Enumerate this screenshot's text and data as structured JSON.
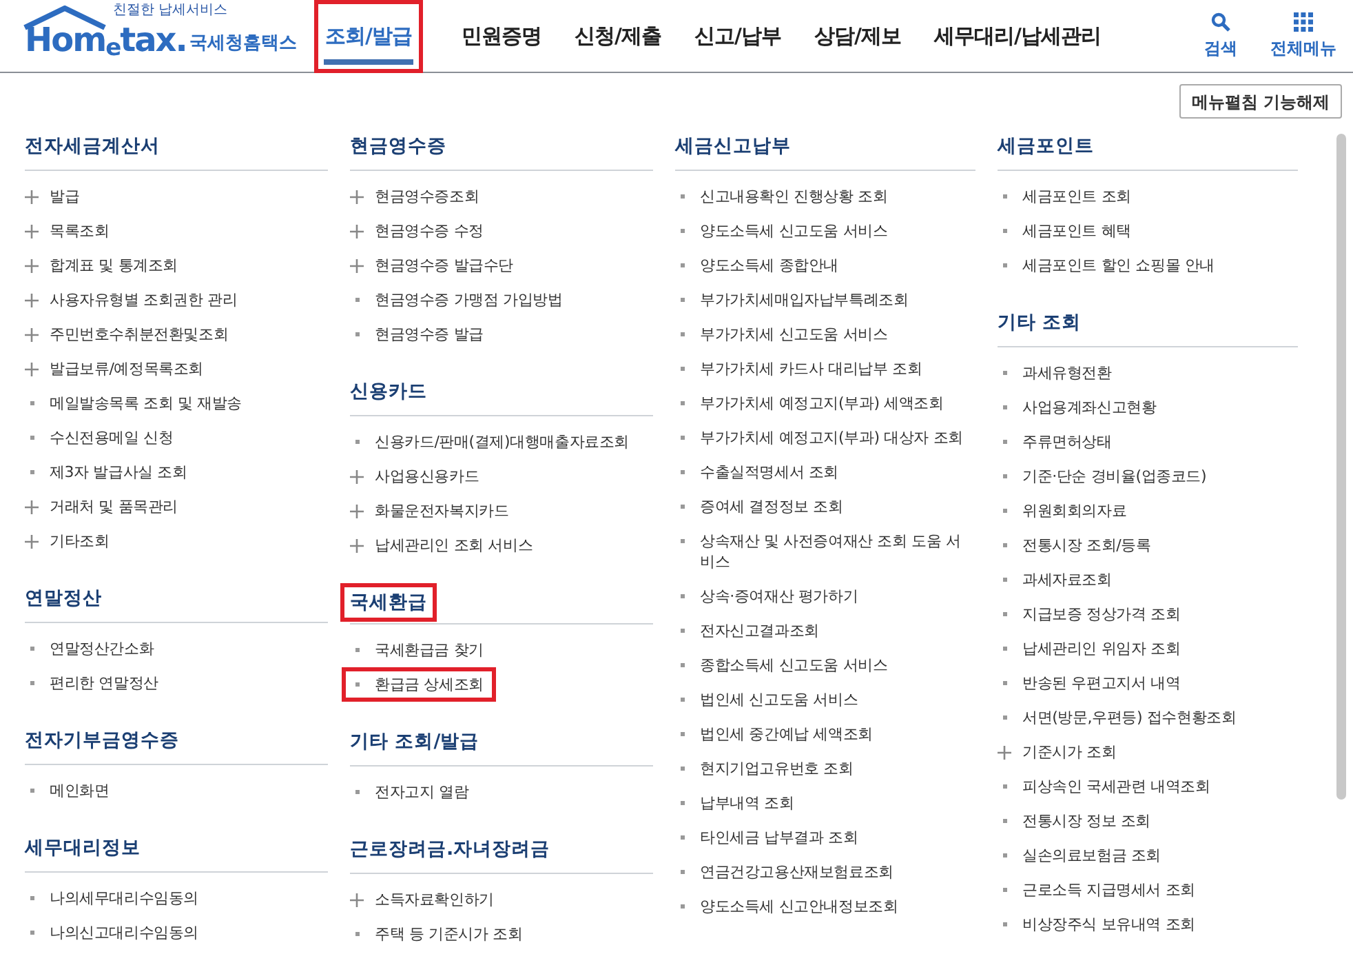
{
  "logo": {
    "slogan": "친절한 납세서비스",
    "wordmark": "Hom$_{e}$tax.",
    "name": "국세청홈택스"
  },
  "tabs": [
    {
      "label": "조회/발급",
      "selected": true,
      "highlighted": true
    },
    {
      "label": "민원증명",
      "selected": false,
      "highlighted": false
    },
    {
      "label": "신청/제출",
      "selected": false,
      "highlighted": false
    },
    {
      "label": "신고/납부",
      "selected": false,
      "highlighted": false
    },
    {
      "label": "상담/제보",
      "selected": false,
      "highlighted": false
    },
    {
      "label": "세무대리/납세관리",
      "selected": false,
      "highlighted": false
    }
  ],
  "tools": [
    {
      "kind": "search",
      "label": "검색"
    },
    {
      "kind": "grid",
      "label": "전체메뉴"
    }
  ],
  "menu_toggle_button": "메뉴펼침 기능해제",
  "columns": [
    [
      {
        "title": "전자세금계산서",
        "highlighted": false,
        "items": [
          {
            "label": "발급",
            "kind": "plus",
            "highlighted": false
          },
          {
            "label": "목록조회",
            "kind": "plus",
            "highlighted": false
          },
          {
            "label": "합계표 및 통계조회",
            "kind": "plus",
            "highlighted": false
          },
          {
            "label": "사용자유형별 조회권한 관리",
            "kind": "plus",
            "highlighted": false
          },
          {
            "label": "주민번호수취분전환및조회",
            "kind": "plus",
            "highlighted": false
          },
          {
            "label": "발급보류/예정목록조회",
            "kind": "plus",
            "highlighted": false
          },
          {
            "label": "메일발송목록 조회 및 재발송",
            "kind": "dot",
            "highlighted": false
          },
          {
            "label": "수신전용메일 신청",
            "kind": "dot",
            "highlighted": false
          },
          {
            "label": "제3자 발급사실 조회",
            "kind": "dot",
            "highlighted": false
          },
          {
            "label": "거래처 및 품목관리",
            "kind": "plus",
            "highlighted": false
          },
          {
            "label": "기타조회",
            "kind": "plus",
            "highlighted": false
          }
        ]
      },
      {
        "title": "연말정산",
        "highlighted": false,
        "items": [
          {
            "label": "연말정산간소화",
            "kind": "dot",
            "highlighted": false
          },
          {
            "label": "편리한 연말정산",
            "kind": "dot",
            "highlighted": false
          }
        ]
      },
      {
        "title": "전자기부금영수증",
        "highlighted": false,
        "items": [
          {
            "label": "메인화면",
            "kind": "dot",
            "highlighted": false
          }
        ]
      },
      {
        "title": "세무대리정보",
        "highlighted": false,
        "items": [
          {
            "label": "나의세무대리수임동의",
            "kind": "dot",
            "highlighted": false
          },
          {
            "label": "나의신고대리수임동의",
            "kind": "dot",
            "highlighted": false
          }
        ]
      }
    ],
    [
      {
        "title": "현금영수증",
        "highlighted": false,
        "items": [
          {
            "label": "현금영수증조회",
            "kind": "plus",
            "highlighted": false
          },
          {
            "label": "현금영수증 수정",
            "kind": "plus",
            "highlighted": false
          },
          {
            "label": "현금영수증 발급수단",
            "kind": "plus",
            "highlighted": false
          },
          {
            "label": "현금영수증 가맹점 가입방법",
            "kind": "dot",
            "highlighted": false
          },
          {
            "label": "현금영수증 발급",
            "kind": "dot",
            "highlighted": false
          }
        ]
      },
      {
        "title": "신용카드",
        "highlighted": false,
        "items": [
          {
            "label": "신용카드/판매(결제)대행매출자료조회",
            "kind": "dot",
            "highlighted": false
          },
          {
            "label": "사업용신용카드",
            "kind": "plus",
            "highlighted": false
          },
          {
            "label": "화물운전자복지카드",
            "kind": "plus",
            "highlighted": false
          },
          {
            "label": "납세관리인 조회 서비스",
            "kind": "plus",
            "highlighted": false
          }
        ]
      },
      {
        "title": "국세환급",
        "highlighted": true,
        "items": [
          {
            "label": "국세환급금 찾기",
            "kind": "dot",
            "highlighted": false
          },
          {
            "label": "환급금 상세조회",
            "kind": "dot",
            "highlighted": true
          }
        ]
      },
      {
        "title": "기타 조회/발급",
        "highlighted": false,
        "items": [
          {
            "label": "전자고지 열람",
            "kind": "dot",
            "highlighted": false
          }
        ]
      },
      {
        "title": "근로장려금.자녀장려금",
        "highlighted": false,
        "items": [
          {
            "label": "소득자료확인하기",
            "kind": "plus",
            "highlighted": false
          },
          {
            "label": "주택 등 기준시가 조회",
            "kind": "dot",
            "highlighted": false
          }
        ]
      }
    ],
    [
      {
        "title": "세금신고납부",
        "highlighted": false,
        "items": [
          {
            "label": "신고내용확인 진행상황 조회",
            "kind": "dot",
            "highlighted": false
          },
          {
            "label": "양도소득세 신고도움 서비스",
            "kind": "dot",
            "highlighted": false
          },
          {
            "label": "양도소득세 종합안내",
            "kind": "dot",
            "highlighted": false
          },
          {
            "label": "부가가치세매입자납부특례조회",
            "kind": "dot",
            "highlighted": false
          },
          {
            "label": "부가가치세 신고도움 서비스",
            "kind": "dot",
            "highlighted": false
          },
          {
            "label": "부가가치세 카드사 대리납부 조회",
            "kind": "dot",
            "highlighted": false
          },
          {
            "label": "부가가치세 예정고지(부과) 세액조회",
            "kind": "dot",
            "highlighted": false
          },
          {
            "label": "부가가치세 예정고지(부과) 대상자 조회",
            "kind": "dot",
            "highlighted": false
          },
          {
            "label": "수출실적명세서 조회",
            "kind": "dot",
            "highlighted": false
          },
          {
            "label": "증여세 결정정보 조회",
            "kind": "dot",
            "highlighted": false
          },
          {
            "label": "상속재산 및 사전증여재산 조회 도움 서비스",
            "kind": "dot",
            "highlighted": false
          },
          {
            "label": "상속·증여재산 평가하기",
            "kind": "dot",
            "highlighted": false
          },
          {
            "label": "전자신고결과조회",
            "kind": "dot",
            "highlighted": false
          },
          {
            "label": "종합소득세 신고도움 서비스",
            "kind": "dot",
            "highlighted": false
          },
          {
            "label": "법인세 신고도움 서비스",
            "kind": "dot",
            "highlighted": false
          },
          {
            "label": "법인세 중간예납 세액조회",
            "kind": "dot",
            "highlighted": false
          },
          {
            "label": "현지기업고유번호 조회",
            "kind": "dot",
            "highlighted": false
          },
          {
            "label": "납부내역 조회",
            "kind": "dot",
            "highlighted": false
          },
          {
            "label": "타인세금 납부결과 조회",
            "kind": "dot",
            "highlighted": false
          },
          {
            "label": "연금건강고용산재보험료조회",
            "kind": "dot",
            "highlighted": false
          },
          {
            "label": "양도소득세 신고안내정보조회",
            "kind": "dot",
            "highlighted": false
          }
        ]
      }
    ],
    [
      {
        "title": "세금포인트",
        "highlighted": false,
        "items": [
          {
            "label": "세금포인트 조회",
            "kind": "dot",
            "highlighted": false
          },
          {
            "label": "세금포인트 혜택",
            "kind": "dot",
            "highlighted": false
          },
          {
            "label": "세금포인트 할인 쇼핑몰 안내",
            "kind": "dot",
            "highlighted": false
          }
        ]
      },
      {
        "title": "기타 조회",
        "highlighted": false,
        "items": [
          {
            "label": "과세유형전환",
            "kind": "dot",
            "highlighted": false
          },
          {
            "label": "사업용계좌신고현황",
            "kind": "dot",
            "highlighted": false
          },
          {
            "label": "주류면허상태",
            "kind": "dot",
            "highlighted": false
          },
          {
            "label": "기준·단순 경비율(업종코드)",
            "kind": "dot",
            "highlighted": false
          },
          {
            "label": "위원회회의자료",
            "kind": "dot",
            "highlighted": false
          },
          {
            "label": "전통시장 조회/등록",
            "kind": "dot",
            "highlighted": false
          },
          {
            "label": "과세자료조회",
            "kind": "dot",
            "highlighted": false
          },
          {
            "label": "지급보증 정상가격 조회",
            "kind": "dot",
            "highlighted": false
          },
          {
            "label": "납세관리인 위임자 조회",
            "kind": "dot",
            "highlighted": false
          },
          {
            "label": "반송된 우편고지서 내역",
            "kind": "dot",
            "highlighted": false
          },
          {
            "label": "서면(방문,우편등) 접수현황조회",
            "kind": "dot",
            "highlighted": false
          },
          {
            "label": "기준시가 조회",
            "kind": "plus",
            "highlighted": false
          },
          {
            "label": "피상속인 국세관련 내역조회",
            "kind": "dot",
            "highlighted": false
          },
          {
            "label": "전통시장 정보 조회",
            "kind": "dot",
            "highlighted": false
          },
          {
            "label": "실손의료보험금 조회",
            "kind": "dot",
            "highlighted": false
          },
          {
            "label": "근로소득 지급명세서 조회",
            "kind": "dot",
            "highlighted": false
          },
          {
            "label": "비상장주식 보유내역 조회",
            "kind": "dot",
            "highlighted": false
          }
        ]
      }
    ]
  ]
}
